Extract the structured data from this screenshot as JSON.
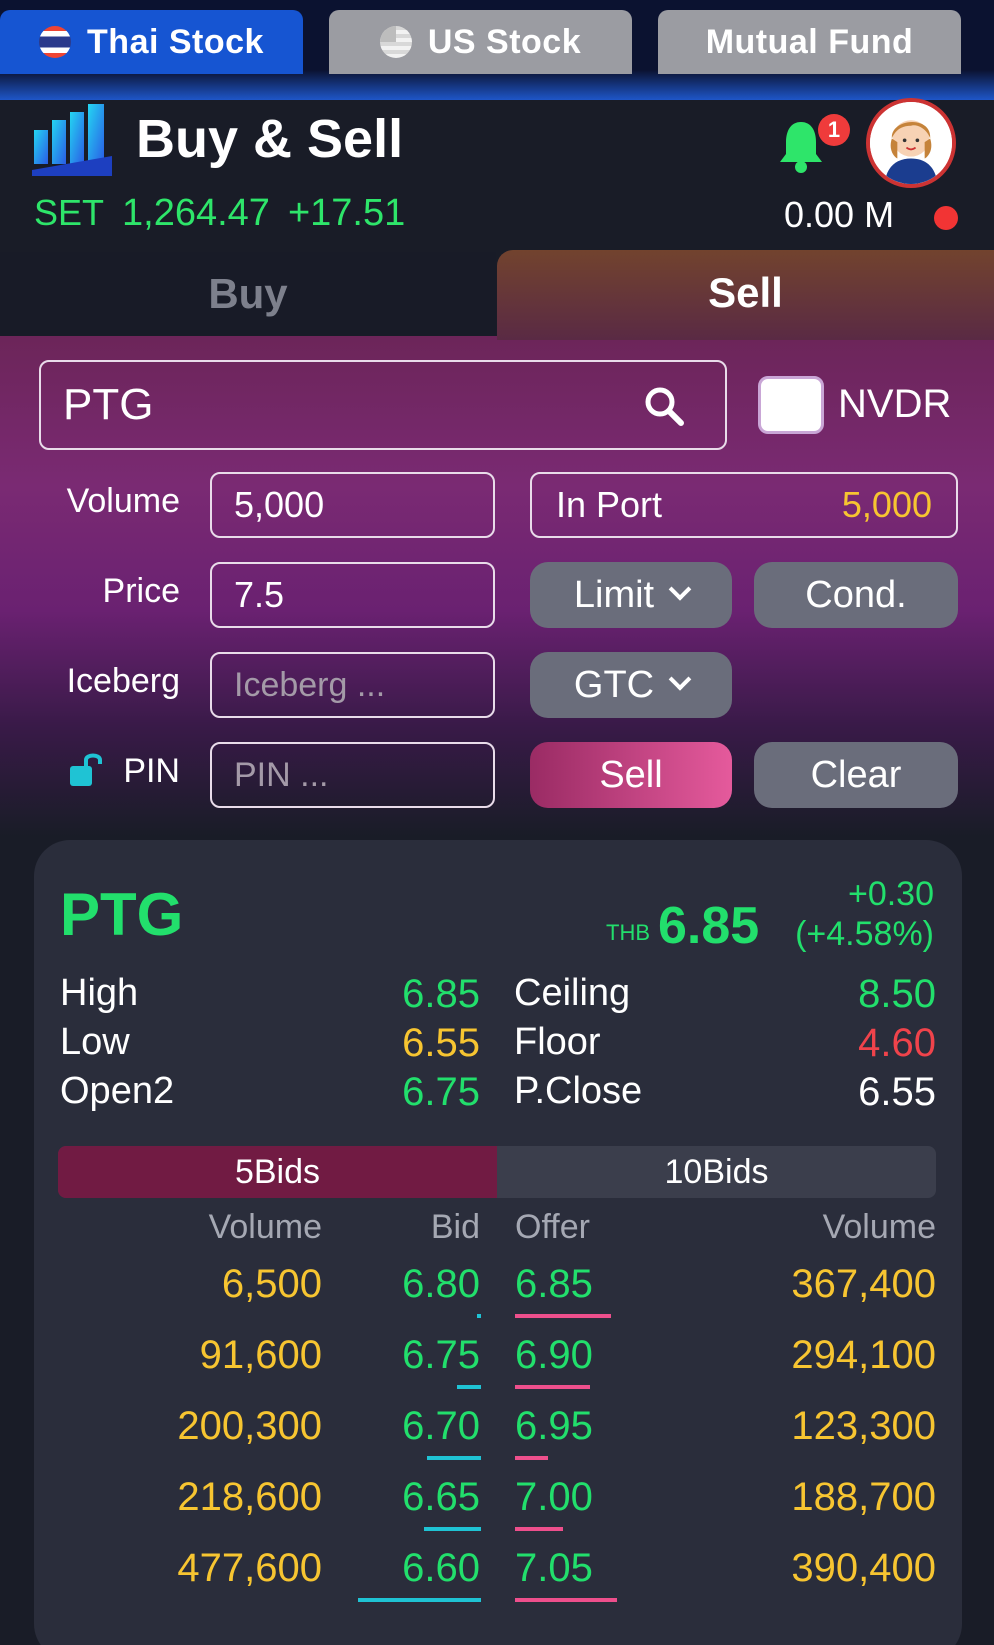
{
  "top_tabs": [
    {
      "label": "Thai Stock",
      "flag": "thailand-flag"
    },
    {
      "label": "US Stock",
      "flag": "us-flag"
    },
    {
      "label": "Mutual Fund"
    }
  ],
  "header": {
    "title": "Buy & Sell",
    "index_label": "SET",
    "index_value": "1,264.47",
    "index_change": "+17.51",
    "notification_count": "1",
    "balance": "0.00 M"
  },
  "side_tabs": {
    "buy": "Buy",
    "sell": "Sell"
  },
  "order_form": {
    "symbol": "PTG",
    "nvdr_label": "NVDR",
    "volume_label": "Volume",
    "volume_value": "5,000",
    "price_label": "Price",
    "price_value": "7.5",
    "iceberg_label": "Iceberg",
    "iceberg_placeholder": "Iceberg ...",
    "pin_label": "PIN",
    "pin_placeholder": "PIN ...",
    "in_port_label": "In Port",
    "in_port_value": "5,000",
    "order_type": "Limit",
    "cond_label": "Cond.",
    "validity": "GTC",
    "sell_button": "Sell",
    "clear_button": "Clear"
  },
  "quote": {
    "symbol": "PTG",
    "currency": "THB",
    "last": "6.85",
    "change": "+0.30",
    "change_pct": "(+4.58%)",
    "stats_left": [
      {
        "label": "High",
        "value": "6.85",
        "color": "#22df6c"
      },
      {
        "label": "Low",
        "value": "6.55",
        "color": "#f7c531"
      },
      {
        "label": "Open2",
        "value": "6.75",
        "color": "#22df6c"
      }
    ],
    "stats_right": [
      {
        "label": "Ceiling",
        "value": "8.50",
        "color": "#22df6c"
      },
      {
        "label": "Floor",
        "value": "4.60",
        "color": "#f0434b"
      },
      {
        "label": "P.Close",
        "value": "6.55",
        "color": "#ffffff"
      }
    ]
  },
  "bids_toggle": {
    "five": "5Bids",
    "ten": "10Bids"
  },
  "order_book": {
    "headers": {
      "bid_volume": "Volume",
      "bid": "Bid",
      "offer": "Offer",
      "offer_volume": "Volume"
    },
    "rows": [
      {
        "bid_volume": "6,500",
        "bid": "6.80",
        "offer": "6.85",
        "offer_volume": "367,400",
        "bid_share": 0.01,
        "offer_share": 0.32
      },
      {
        "bid_volume": "91,600",
        "bid": "6.75",
        "offer": "6.90",
        "offer_volume": "294,100",
        "bid_share": 0.08,
        "offer_share": 0.25
      },
      {
        "bid_volume": "200,300",
        "bid": "6.70",
        "offer": "6.95",
        "offer_volume": "123,300",
        "bid_share": 0.18,
        "offer_share": 0.11
      },
      {
        "bid_volume": "218,600",
        "bid": "6.65",
        "offer": "7.00",
        "offer_volume": "188,700",
        "bid_share": 0.19,
        "offer_share": 0.16
      },
      {
        "bid_volume": "477,600",
        "bid": "6.60",
        "offer": "7.05",
        "offer_volume": "390,400",
        "bid_share": 0.41,
        "offer_share": 0.34
      }
    ]
  },
  "colors": {
    "positive": "#22df6c",
    "bid_volume": "#f7c531",
    "bid_bar": "#1fc3d4",
    "offer_bar": "#ee4f8c"
  }
}
